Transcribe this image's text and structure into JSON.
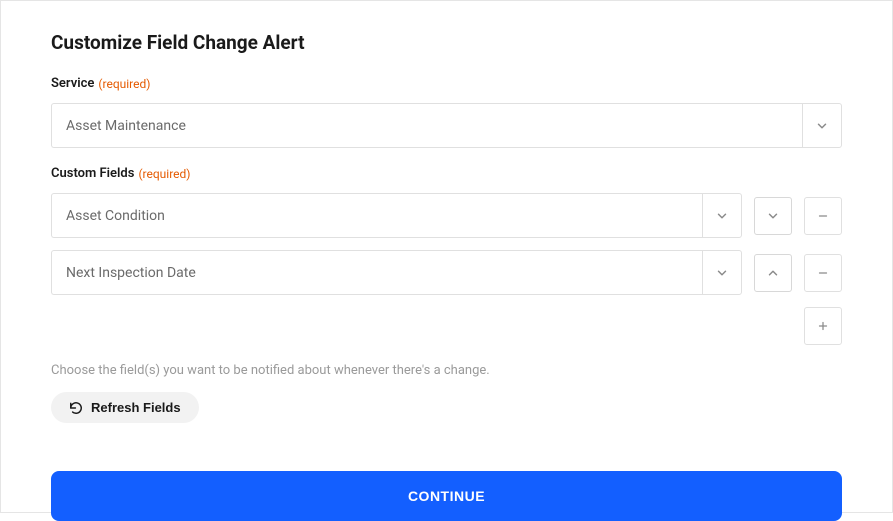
{
  "title": "Customize Field Change Alert",
  "service": {
    "label": "Service",
    "required_text": "(required)",
    "value": "Asset Maintenance"
  },
  "custom_fields": {
    "label": "Custom Fields",
    "required_text": "(required)",
    "items": [
      {
        "value": "Asset Condition"
      },
      {
        "value": "Next Inspection Date"
      }
    ]
  },
  "helper_text": "Choose the field(s) you want to be notified about whenever there's a change.",
  "refresh_label": "Refresh Fields",
  "continue_label": "CONTINUE",
  "icons": {
    "chevron_down": "chevron-down-icon",
    "chevron_up": "chevron-up-icon",
    "minus": "minus-icon",
    "plus": "plus-icon",
    "refresh": "refresh-icon"
  }
}
